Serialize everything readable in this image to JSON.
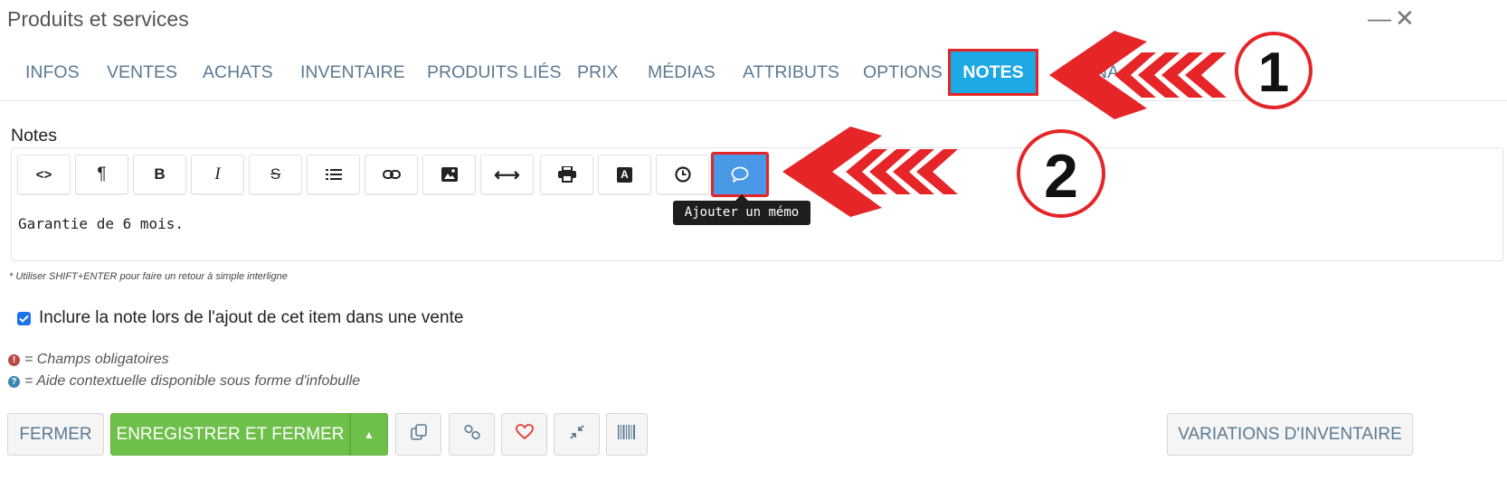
{
  "window": {
    "title": "Produits et services",
    "minimize_symbol": "—",
    "close_symbol": "✕"
  },
  "tabs": [
    {
      "label": "INFOS"
    },
    {
      "label": "VENTES"
    },
    {
      "label": "ACHATS"
    },
    {
      "label": "INVENTAIRE"
    },
    {
      "label": "PRODUITS LIÉS"
    },
    {
      "label": "PRIX"
    },
    {
      "label": "MÉDIAS"
    },
    {
      "label": "ATTRIBUTS"
    },
    {
      "label": "OPTIONS"
    },
    {
      "label": "NOTES",
      "active": true
    },
    {
      "label": "NA"
    }
  ],
  "notes": {
    "section_label": "Notes",
    "toolbar": [
      {
        "icon": "code-view-icon",
        "symbol": "<>"
      },
      {
        "icon": "paragraph-icon",
        "symbol": "¶"
      },
      {
        "icon": "bold-icon",
        "symbol": "B"
      },
      {
        "icon": "italic-icon",
        "symbol": "I"
      },
      {
        "icon": "strikethrough-icon",
        "symbol": "S"
      },
      {
        "icon": "list-icon",
        "symbol": "list"
      },
      {
        "icon": "link-icon",
        "symbol": "link"
      },
      {
        "icon": "image-icon",
        "symbol": "image"
      },
      {
        "icon": "horizontal-rule-icon",
        "symbol": "⟷"
      },
      {
        "icon": "print-icon",
        "symbol": "print"
      },
      {
        "icon": "font-color-icon",
        "symbol": "A"
      },
      {
        "icon": "clock-icon",
        "symbol": "clock"
      },
      {
        "icon": "comment-memo-icon",
        "symbol": "comment",
        "active": true
      }
    ],
    "tooltip": "Ajouter un mémo",
    "content": "Garantie de 6 mois.",
    "hint": "* Utiliser SHIFT+ENTER pour faire un retour à simple interligne"
  },
  "include_note": {
    "checked": true,
    "label": "Inclure la note lors de l'ajout de cet item dans une vente"
  },
  "legend": {
    "required": {
      "symbol": "!",
      "text": "= Champs obligatoires",
      "color": "#b94a48"
    },
    "help": {
      "symbol": "?",
      "text": "= Aide contextuelle disponible sous forme d'infobulle",
      "color": "#3a87ad"
    }
  },
  "footer": {
    "close_label": "FERMER",
    "save_close_label": "ENREGISTRER ET FERMER",
    "caret_symbol": "▲",
    "icon_buttons": [
      "copy-icon",
      "link-icon",
      "heart-icon",
      "compress-icon",
      "barcode-icon"
    ],
    "variations_label": "VARIATIONS D'INVENTAIRE"
  },
  "annotations": {
    "step1": "1",
    "step2": "2"
  },
  "colors": {
    "accent": "#1ca7e5",
    "highlight": "#e52528",
    "save_green": "#6fbf4b",
    "tab_text": "#5b7a93"
  }
}
